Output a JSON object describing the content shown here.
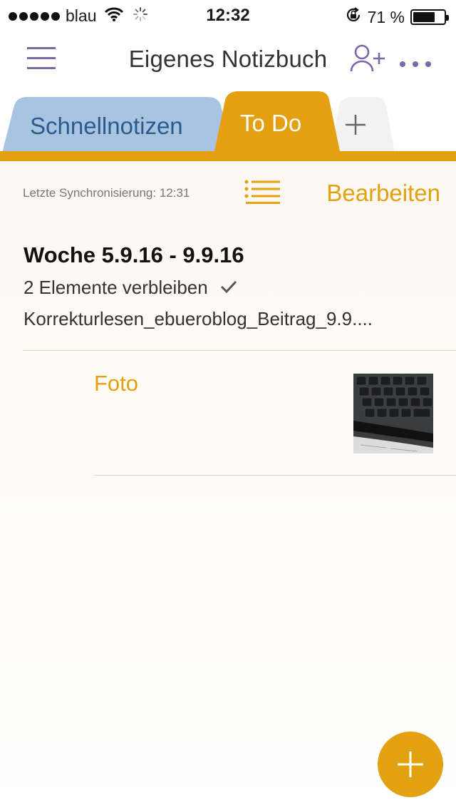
{
  "status_bar": {
    "carrier": "blau",
    "time": "12:32",
    "battery_percent": "71 %",
    "battery_level": 0.71
  },
  "nav": {
    "title": "Eigenes Notizbuch",
    "icons": [
      "menu-icon",
      "add-person-icon",
      "more-icon"
    ]
  },
  "tabs": [
    {
      "label": "Schnellnotizen",
      "color": "#a8c4e0"
    },
    {
      "label": "To Do",
      "color": "#e3a011",
      "selected": true
    },
    {
      "label": "+",
      "color": "#f2f2f2"
    }
  ],
  "toolbar": {
    "sync_text": "Letzte Synchronisierung: 12:31",
    "edit_label": "Bearbeiten"
  },
  "section": {
    "title": "Woche 5.9.16 - 9.9.16",
    "remaining": "2 Elemente verbleiben",
    "page_preview": "Korrekturlesen_ebueroblog_Beitrag_9.9...."
  },
  "pages": [
    {
      "title": "Foto",
      "thumbnail": "keyboard-photo"
    }
  ],
  "colors": {
    "accent": "#e3a011",
    "tab_blue": "#a8c4e0",
    "purple": "#7b68a6"
  }
}
